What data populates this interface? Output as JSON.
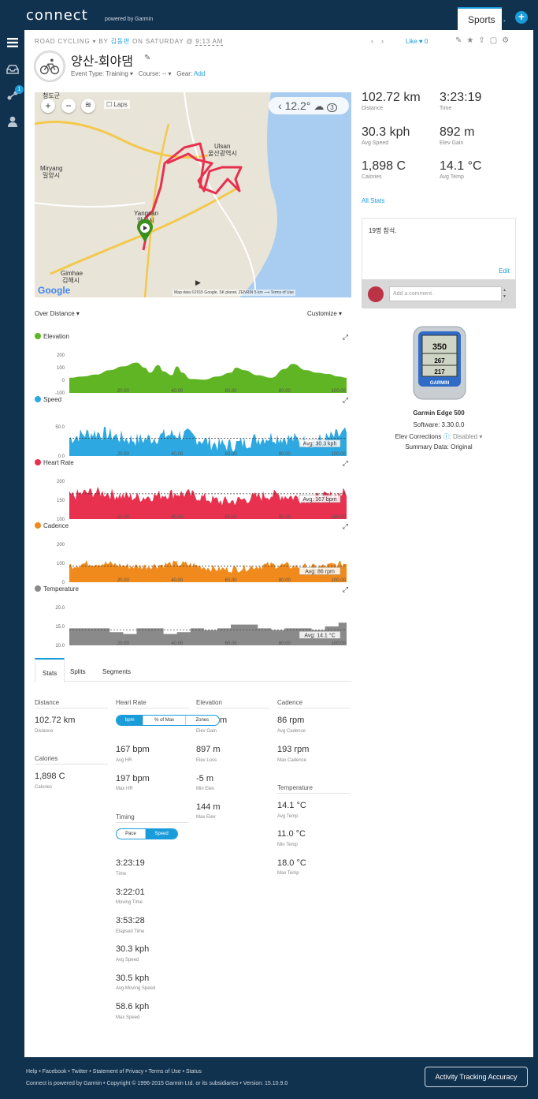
{
  "header": {
    "logo": "connect",
    "powered_by": "powered by Garmin",
    "tab_sports": "Sports",
    "add_label": "+"
  },
  "sidebar": {
    "badge": "1"
  },
  "activity": {
    "breadcrumb_type": "ROAD CYCLING",
    "breadcrumb_by": "BY",
    "owner": "김동판",
    "breadcrumb_on": "ON SATURDAY @",
    "time": "9:13 AM",
    "like_label": "Like",
    "like_count": "0",
    "title": "양산-회야댐",
    "event_type_label": "Event Type:",
    "event_type_value": "Training",
    "course_label": "Course:",
    "course_value": "--",
    "gear_label": "Gear:",
    "gear_add": "Add"
  },
  "map": {
    "laps_label": "Laps",
    "temperature": "12.2°",
    "weather_count": "3",
    "labels": {
      "cheongdo": "청도군",
      "miryang_en": "Miryang",
      "miryang_kr": "밀양시",
      "ulsan_en": "Ulsan",
      "ulsan_kr": "울산광역시",
      "yangsan_en": "Yangsan",
      "yangsan_kr": "양산시",
      "gimhae_en": "Gimhae",
      "gimhae_kr": "김해시"
    },
    "google": "Google",
    "attribution": "Map data ©2015 Google, SK planet, ZENRIN   5 km ⟶   Terms of Use"
  },
  "summary": {
    "distance": {
      "value": "102.72 km",
      "label": "Distance"
    },
    "time": {
      "value": "3:23:19",
      "label": "Time"
    },
    "avg_speed": {
      "value": "30.3 kph",
      "label": "Avg Speed"
    },
    "elev_gain": {
      "value": "892 m",
      "label": "Elev Gain"
    },
    "calories": {
      "value": "1,898 C",
      "label": "Calories"
    },
    "avg_temp": {
      "value": "14.1 °C",
      "label": "Avg Temp"
    },
    "all_stats": "All Stats"
  },
  "notes": {
    "text": "19명 참석.",
    "edit": "Edit",
    "comment_placeholder": "Add a comment."
  },
  "device": {
    "name": "Garmin Edge 500",
    "software": "Software: 3.30.0.0",
    "elev_corrections_label": "Elev Corrections",
    "elev_corrections_value": ": Disabled",
    "summary_data": "Summary Data: Original",
    "screen_top": "350",
    "screen_mid": "267",
    "screen_bot": "217"
  },
  "charts_header": {
    "over_distance": "Over Distance",
    "customize": "Customize"
  },
  "chart_data": [
    {
      "type": "area",
      "title": "Elevation",
      "color": "#5fb523",
      "y_ticks": [
        "200",
        "100",
        "0",
        "-100"
      ],
      "ylim": [
        -100,
        200
      ],
      "x_ticks": [
        "20.00",
        "40.00",
        "60.00",
        "80.00",
        "100.00"
      ],
      "x": [
        0,
        5,
        10,
        15,
        20,
        25,
        28,
        30,
        33,
        35,
        38,
        40,
        42,
        45,
        50,
        55,
        60,
        62,
        65,
        70,
        75,
        80,
        83,
        88,
        92,
        96,
        100,
        103
      ],
      "values": [
        20,
        30,
        45,
        80,
        110,
        140,
        100,
        60,
        120,
        70,
        40,
        110,
        60,
        10,
        5,
        30,
        60,
        100,
        80,
        40,
        20,
        90,
        130,
        80,
        60,
        50,
        30,
        20
      ]
    },
    {
      "type": "area",
      "title": "Speed",
      "color": "#2ea8e0",
      "y_ticks": [
        "50.0",
        "0.0"
      ],
      "ylim": [
        0,
        65
      ],
      "x_ticks": [
        "20.00",
        "40.00",
        "60.00",
        "80.00",
        "100.00"
      ],
      "avg_label": "Avg: 30.3 kph",
      "avg": 30.3
    },
    {
      "type": "area",
      "title": "Heart Rate",
      "color": "#e8314f",
      "y_ticks": [
        "200",
        "150",
        "100"
      ],
      "ylim": [
        100,
        200
      ],
      "x_ticks": [
        "20.00",
        "40.00",
        "60.00",
        "80.00",
        "100.00"
      ],
      "avg_label": "Avg: 167 bpm",
      "avg": 167
    },
    {
      "type": "area",
      "title": "Cadence",
      "color": "#f08a1c",
      "y_ticks": [
        "200",
        "100",
        "0"
      ],
      "ylim": [
        0,
        200
      ],
      "x_ticks": [
        "20.00",
        "40.00",
        "60.00",
        "80.00",
        "100.00"
      ],
      "avg_label": "Avg: 86 rpm",
      "avg": 86
    },
    {
      "type": "area",
      "title": "Temperature",
      "color": "#8a8a8a",
      "y_ticks": [
        "20.0",
        "15.0",
        "10.0"
      ],
      "ylim": [
        10,
        20
      ],
      "x_ticks": [
        "20.00",
        "40.00",
        "60.00",
        "80.00",
        "100.00"
      ],
      "avg_label": "Avg: 14.1 °C",
      "avg": 14.1,
      "x": [
        0,
        8,
        15,
        20,
        25,
        30,
        35,
        40,
        45,
        50,
        55,
        60,
        65,
        70,
        75,
        80,
        85,
        90,
        95,
        100,
        103
      ],
      "values": [
        14.5,
        14.5,
        13.5,
        13.0,
        14.5,
        14.5,
        13.0,
        13.5,
        14.5,
        14.0,
        14.5,
        15.5,
        15.5,
        14.5,
        14.0,
        14.5,
        14.5,
        14.0,
        15.0,
        16.0,
        17.5
      ]
    }
  ],
  "tabs": [
    "Stats",
    "Splits",
    "Segments"
  ],
  "stats": {
    "distance_head": "Distance",
    "distance_val": "102.72 km",
    "distance_lab": "Distance",
    "calories_head": "Calories",
    "calories_val": "1,898 C",
    "calories_lab": "Calories",
    "hr_head": "Heart Rate",
    "hr_toggle": [
      "bpm",
      "% of Max",
      "Zones"
    ],
    "avg_hr_val": "167 bpm",
    "avg_hr_lab": "Avg HR",
    "max_hr_val": "197 bpm",
    "max_hr_lab": "Max HR",
    "timing_head": "Timing",
    "timing_toggle": [
      "Pace",
      "Speed"
    ],
    "time_val": "3:23:19",
    "time_lab": "Time",
    "moving_val": "3:22:01",
    "moving_lab": "Moving Time",
    "elapsed_val": "3:53:28",
    "elapsed_lab": "Elapsed Time",
    "avg_speed_val": "30.3 kph",
    "avg_speed_lab": "Avg Speed",
    "avg_moving_val": "30.5 kph",
    "avg_moving_lab": "Avg Moving Speed",
    "max_speed_val": "58.6 kph",
    "max_speed_lab": "Max Speed",
    "elev_head": "Elevation",
    "elev_gain_val": "m",
    "elev_gain_lab": "Elev Gain",
    "elev_loss_val": "897 m",
    "elev_loss_lab": "Elev Loss",
    "min_elev_val": "-5 m",
    "min_elev_lab": "Min Elev",
    "max_elev_val": "144 m",
    "max_elev_lab": "Max Elev",
    "cad_head": "Cadence",
    "avg_cad_val": "86 rpm",
    "avg_cad_lab": "Avg Cadence",
    "max_cad_val": "193 rpm",
    "max_cad_lab": "Max Cadence",
    "temp_head": "Temperature",
    "avg_temp_val": "14.1 °C",
    "avg_temp_lab": "Avg Temp",
    "min_temp_val": "11.0 °C",
    "min_temp_lab": "Min Temp",
    "max_temp_val": "18.0 °C",
    "max_temp_lab": "Max Temp"
  },
  "footer": {
    "links": "Help • Facebook • Twitter • Statement of Privacy • Terms of Use • Status",
    "copyright": "Connect is powered by Garmin • Copyright © 1996-2015 Garmin Ltd. or its subsidiaries • Version: 15.10.9.0",
    "tracking_button": "Activity Tracking Accuracy"
  },
  "colors": {
    "accent": "#1a9cdb",
    "navy": "#11324f"
  }
}
